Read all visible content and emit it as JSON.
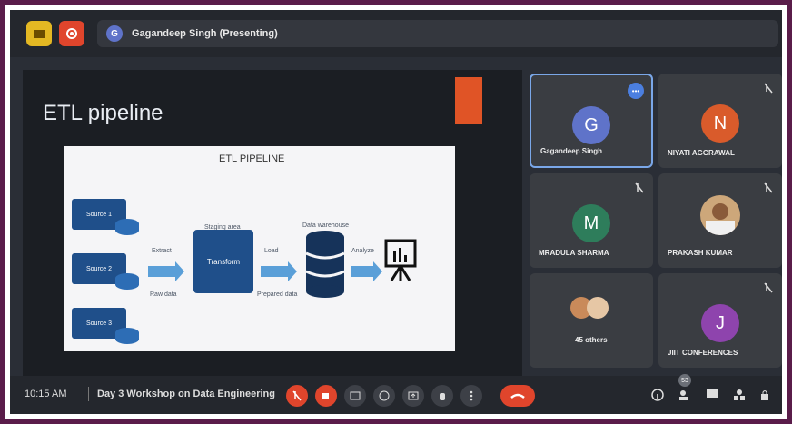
{
  "top": {
    "presenter_initial": "G",
    "presenter_label": "Gagandeep Singh (Presenting)"
  },
  "slide": {
    "title": "ETL pipeline",
    "diagram_title": "ETL PIPELINE",
    "sources": [
      "Source 1",
      "Source 2",
      "Source 3"
    ],
    "extract_label": "Extract",
    "raw_data_label": "Raw data",
    "staging_label": "Staging area",
    "transform_label": "Transform",
    "load_label": "Load",
    "prepared_label": "Prepared data",
    "warehouse_label": "Data warehouse",
    "analyze_label": "Analyze"
  },
  "tiles": [
    {
      "name": "Gagandeep Singh",
      "initial": "G",
      "color": "#5f73c9",
      "active": true
    },
    {
      "name": "NIYATI AGGRAWAL",
      "initial": "N",
      "color": "#d95b2b"
    },
    {
      "name": "MRADULA SHARMA",
      "initial": "M",
      "color": "#2e7d5b"
    },
    {
      "name": "PRAKASH KUMAR",
      "initial": "",
      "color": "#cda77a"
    },
    {
      "name": "45 others",
      "initial": "",
      "color": "#c9c9c9"
    },
    {
      "name": "JIIT CONFERENCES",
      "initial": "J",
      "color": "#8e44ad"
    }
  ],
  "bottom": {
    "time": "10:15 AM",
    "meeting_title": "Day 3 Workshop on Data Engineering",
    "participants_count": "53"
  },
  "colors": {
    "accent": "#e0452c",
    "yellow": "#e4b823"
  }
}
